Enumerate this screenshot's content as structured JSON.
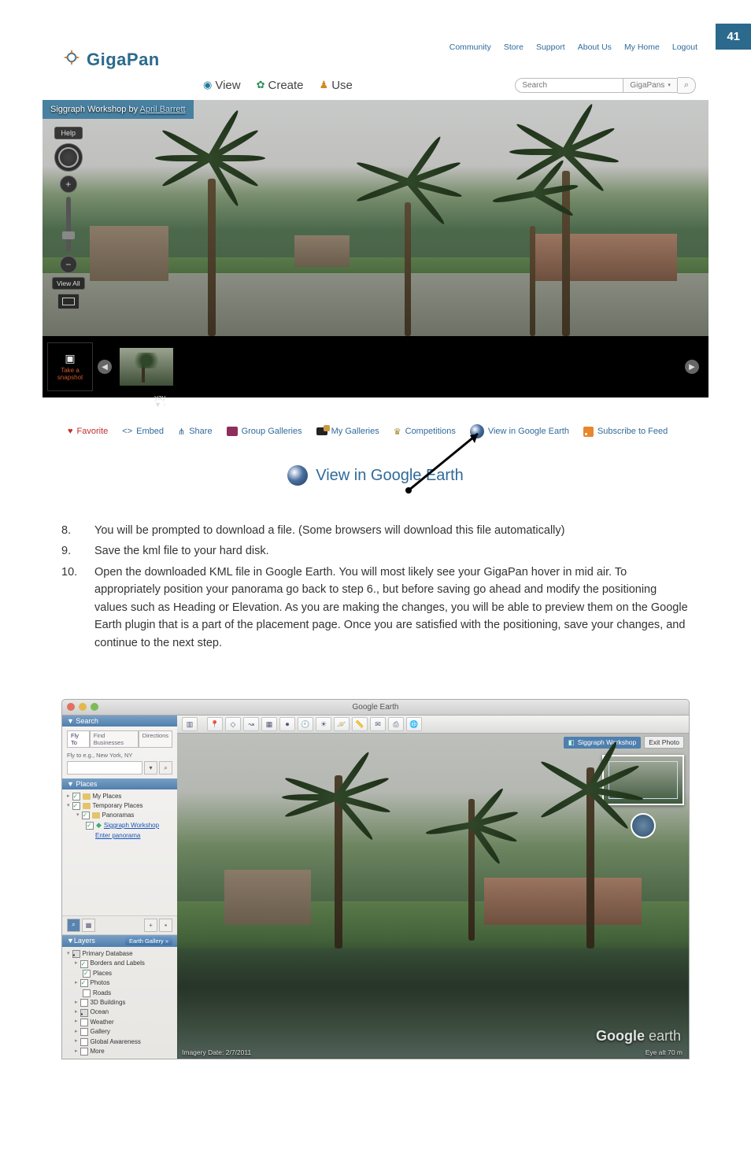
{
  "page_number": "41",
  "gigapan": {
    "brand": "GigaPan",
    "top_links": [
      "Community",
      "Store",
      "Support",
      "About Us",
      "My Home",
      "Logout"
    ],
    "nav": {
      "view": "View",
      "create": "Create",
      "use": "Use"
    },
    "search": {
      "placeholder": "Search",
      "scope": "GigaPans"
    },
    "pano_title_prefix": "Siggraph Workshop by ",
    "pano_author": "April Barrett",
    "controls": {
      "help": "Help",
      "view_all": "View All"
    },
    "snapshot": {
      "take": "Take a\nsnapshot",
      "thumb_caption": "yay"
    },
    "actions": {
      "favorite": "Favorite",
      "embed": "Embed",
      "share": "Share",
      "group_galleries": "Group Galleries",
      "my_galleries": "My Galleries",
      "competitions": "Competitions",
      "view_ge": "View in Google Earth",
      "subscribe": "Subscribe to Feed"
    },
    "view_ge_big": "View in Google Earth"
  },
  "instructions": [
    {
      "n": "8.",
      "t": "You will be prompted to download a file. (Some browsers will download this file automatically)"
    },
    {
      "n": "9.",
      "t": "Save the kml file to your hard disk."
    },
    {
      "n": "10.",
      "t": "Open the downloaded KML file in Google Earth. You will most likely see your GigaPan hover in mid air. To appropriately position your panorama go back to step 6., but before saving go ahead and modify the positioning values such as Heading or Elevation. As you are making the changes, you will be able to preview them on the Google Earth plugin that is a part of the placement page. Once you are satisfied with the positioning, save your changes, and continue to the next step."
    }
  ],
  "ge": {
    "title": "Google Earth",
    "search_hdr": "Search",
    "search_tabs": [
      "Fly To",
      "Find Businesses",
      "Directions"
    ],
    "fly_label": "Fly to e.g., New York, NY",
    "places_hdr": "Places",
    "places": {
      "my_places": "My Places",
      "temp": "Temporary Places",
      "panoramas": "Panoramas",
      "siggraph": "Siggraph Workshop",
      "enter": "Enter panorama"
    },
    "earth_gallery": "Earth Gallery »",
    "layers_hdr": "Layers",
    "layers": [
      "Primary Database",
      "Borders and Labels",
      "Places",
      "Photos",
      "Roads",
      "3D Buildings",
      "Ocean",
      "Weather",
      "Gallery",
      "Global Awareness",
      "More"
    ],
    "overlay_label": "Siggraph Workshop",
    "exit_photo": "Exit Photo",
    "logo": "Google earth",
    "imagery": "Imagery Date: 2/7/2011",
    "eyealt": "Eye alt     70 m"
  }
}
